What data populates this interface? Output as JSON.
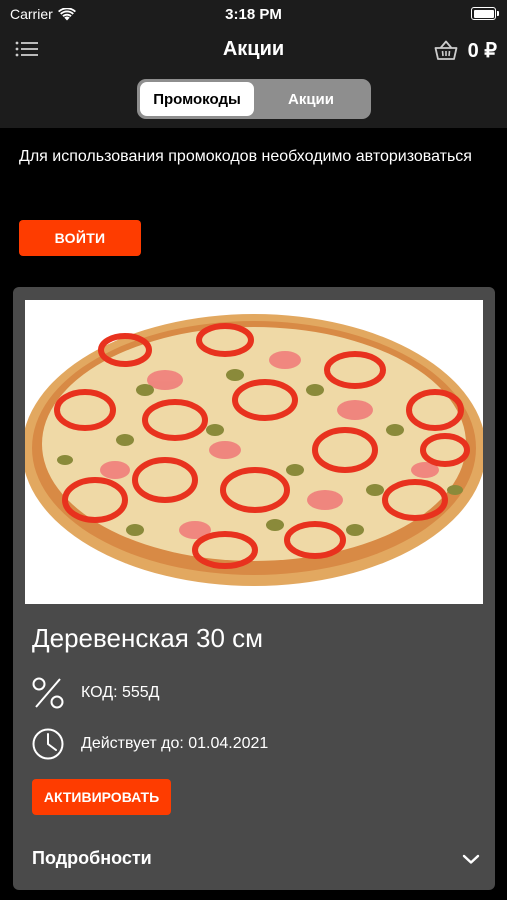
{
  "status_bar": {
    "carrier": "Carrier",
    "time": "3:18 PM"
  },
  "nav": {
    "title": "Акции",
    "cart_total": "0 ₽"
  },
  "segments": [
    {
      "label": "Промокоды",
      "active": true
    },
    {
      "label": "Акции",
      "active": false
    }
  ],
  "promo": {
    "notice": "Для использования промокодов необходимо авторизоваться",
    "login_label": "ВОЙТИ"
  },
  "card": {
    "title": "Деревенская 30 см",
    "code_text": "КОД: 555Д",
    "valid_text": "Действует до: 01.04.2021",
    "activate_label": "АКТИВИРОВАТЬ",
    "details_label": "Подробности"
  },
  "colors": {
    "accent": "#fe3c00",
    "header_bg": "#1c1c1c",
    "card_bg": "#4a4a4a"
  },
  "icons": [
    "wifi-icon",
    "battery-icon",
    "menu-icon",
    "basket-icon",
    "percent-icon",
    "clock-icon",
    "chevron-down-icon"
  ]
}
